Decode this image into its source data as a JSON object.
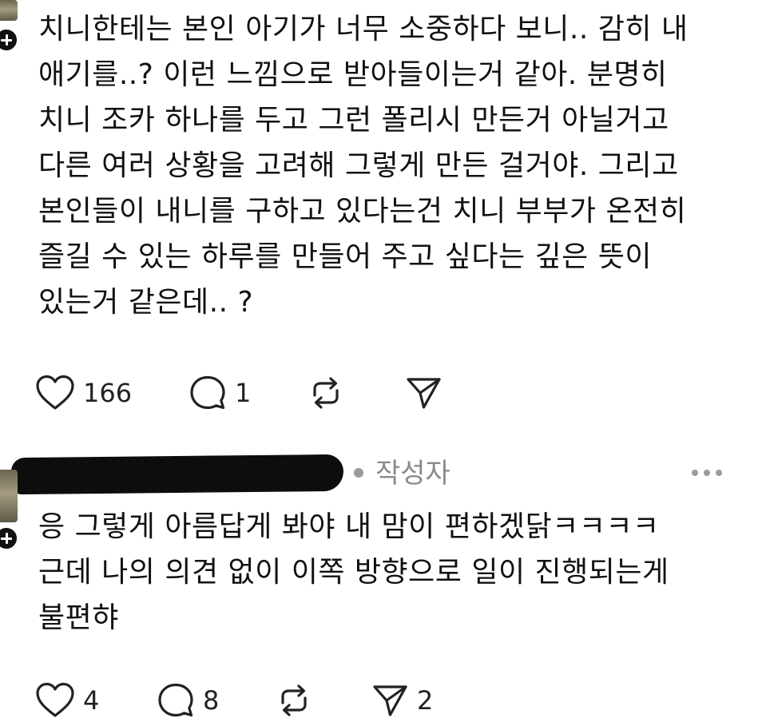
{
  "comment1": {
    "text": "치니한테는 본인 아기가 너무 소중하다 보니.. 감히 내\n애기를..? 이런 느낌으로 받아들이는거 같아. 분명히\n치니 조카 하나를 두고 그런 폴리시 만든거 아닐거고\n다른 여러 상황을 고려해 그렇게 만든 걸거야. 그리고\n본인들이 내니를 구하고 있다는건 치니 부부가 온전히\n즐길 수 있는 하루를 만들어 주고 싶다는 깊은 뜻이\n있는거 같은데.. ?",
    "likes": "166",
    "replies": "1"
  },
  "comment2": {
    "author_label": "작성자",
    "text": "응 그렇게 아름답게 봐야 내 맘이 편하겠닭ㅋㅋㅋㅋ\n근데 나의 의견 없이 이쪽 방향으로 일이 진행되는게\n불편햐",
    "likes": "4",
    "replies": "8",
    "shares": "2"
  },
  "icons": {
    "avatar_plus": "plus-icon",
    "like": "heart-icon",
    "reply": "speech-bubble-icon",
    "repost": "repost-icon",
    "share": "send-icon",
    "more": "ellipsis-icon"
  },
  "colors": {
    "text": "#111111",
    "muted": "#8a8a8a",
    "icon": "#222222",
    "background": "#ffffff"
  }
}
